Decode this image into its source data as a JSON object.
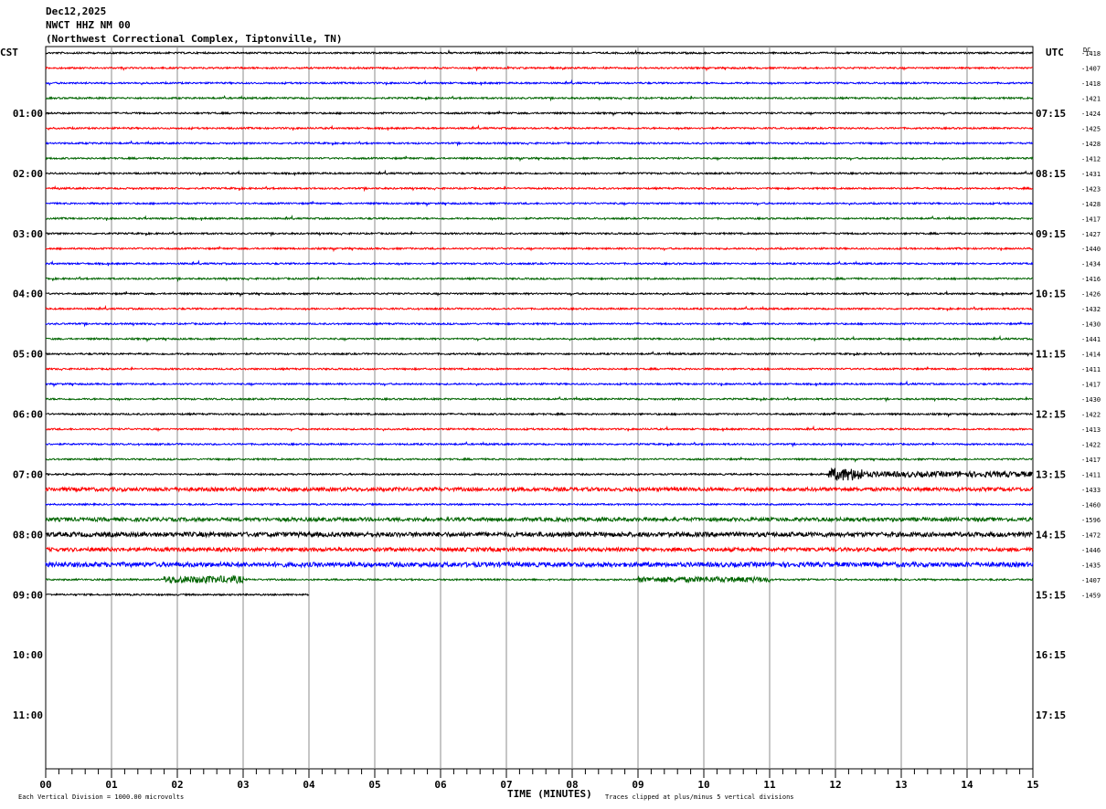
{
  "header": {
    "date": "Dec12,2025",
    "station": "NWCT HHZ NM 00",
    "location": "(Northwest Correctional Complex, Tiptonville, TN)"
  },
  "left_tz": "CST",
  "right_tz": "UTC",
  "dc_label": "DC",
  "footer": {
    "scale_note": "Each Vertical Division = 1000.00 microvolts",
    "clip_note": "Traces clipped at plus/minus 5 vertical divisions",
    "xlabel": "TIME (MINUTES)"
  },
  "chart_data": {
    "type": "line",
    "subtype": "helicorder",
    "xlabel": "TIME (MINUTES)",
    "xlim": [
      0,
      15
    ],
    "x_ticks": [
      "00",
      "01",
      "02",
      "03",
      "04",
      "05",
      "06",
      "07",
      "08",
      "09",
      "10",
      "11",
      "12",
      "13",
      "14",
      "15"
    ],
    "rows_per_hour": 4,
    "hours": 12,
    "left_hour_labels": [
      "01:00",
      "02:00",
      "03:00",
      "04:00",
      "05:00",
      "06:00",
      "07:00",
      "08:00",
      "09:00",
      "10:00",
      "11:00"
    ],
    "right_hour_labels": [
      "07:15",
      "08:15",
      "09:15",
      "10:15",
      "11:15",
      "12:15",
      "13:15",
      "14:15",
      "15:15",
      "16:15",
      "17:15"
    ],
    "trace_colors": [
      "#000000",
      "#ff0000",
      "#0000ff",
      "#006400"
    ],
    "trace_count": 37,
    "last_trace_minutes": 4,
    "dc_offsets": [
      "-1418",
      "-1407",
      "-1418",
      "-1421",
      "-1424",
      "-1425",
      "-1428",
      "-1412",
      "-1431",
      "-1423",
      "-1428",
      "-1417",
      "-1427",
      "-1440",
      "-1434",
      "-1416",
      "-1426",
      "-1432",
      "-1430",
      "-1441",
      "-1414",
      "-1411",
      "-1417",
      "-1430",
      "-1422",
      "-1413",
      "-1422",
      "-1417",
      "-1411",
      "-1433",
      "-1460",
      "-1596",
      "-1472",
      "-1446",
      "-1435",
      "-1407",
      "-1459"
    ],
    "grid": true
  }
}
